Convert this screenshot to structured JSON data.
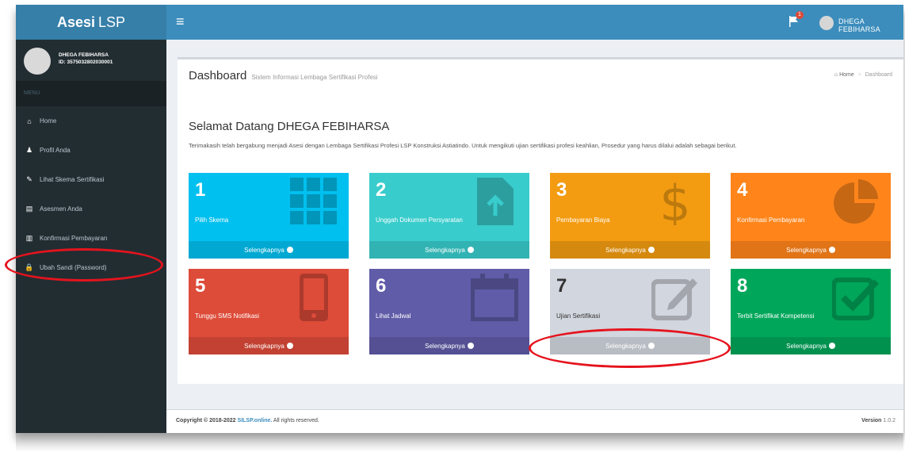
{
  "app": {
    "logo_bold": "Asesi",
    "logo_rest": "LSP"
  },
  "navbar": {
    "toggle_icon": "≡",
    "notification_count": "1",
    "user_name": "DHEGA FEBIHARSA"
  },
  "sidebar": {
    "user_name": "DHEGA FEBIHARSA",
    "user_id": "ID: 3575032802030001",
    "header": "MENU",
    "items": [
      {
        "label": "Home",
        "icon": "home-icon",
        "glyph": "⌂"
      },
      {
        "label": "Profil Anda",
        "icon": "user-icon",
        "glyph": "♟"
      },
      {
        "label": "Lihat Skema Sertifikasi",
        "icon": "edit-icon",
        "glyph": "✎"
      },
      {
        "label": "Asesmen Anda",
        "icon": "file-icon",
        "glyph": "▤"
      },
      {
        "label": "Konfirmasi Pembayaran",
        "icon": "barcode-icon",
        "glyph": "▥"
      },
      {
        "label": "Ubah Sandi (Password)",
        "icon": "lock-icon",
        "glyph": "🔒"
      }
    ]
  },
  "page": {
    "title": "Dashboard",
    "subtitle": "Sistem Informasi Lembaga Sertifikasi Profesi",
    "breadcrumb_home": "Home",
    "breadcrumb_current": "Dashboard",
    "welcome": "Selamat Datang DHEGA FEBIHARSA",
    "description": "Terimakasih telah bergabung menjadi Asesi dengan Lembaga Sertifikasi Profesi LSP Konstruksi Astiatindo. Untuk mengikuti ujian sertifikasi profesi keahlian, Prosedur yang harus dilalui adalah sebagai berikut."
  },
  "tiles": [
    {
      "number": "1",
      "label": "Pilih Skema",
      "more": "Selengkapnya",
      "color": "#00c0ef",
      "icon": "grid-icon"
    },
    {
      "number": "2",
      "label": "Unggah Dokumen Persyaratan",
      "more": "Selengkapnya",
      "color": "#39cccc",
      "icon": "document-upload-icon"
    },
    {
      "number": "3",
      "label": "Pembayaran Biaya",
      "more": "Selengkapnya",
      "color": "#f39c12",
      "icon": "dollar-icon"
    },
    {
      "number": "4",
      "label": "Konfirmasi Pembayaran",
      "more": "Selengkapnya",
      "color": "#ff851b",
      "icon": "pie-chart-icon"
    },
    {
      "number": "5",
      "label": "Tunggu SMS Notifikasi",
      "more": "Selengkapnya",
      "color": "#dd4b39",
      "icon": "mobile-phone-icon"
    },
    {
      "number": "6",
      "label": "Lihat Jadwal",
      "more": "Selengkapnya",
      "color": "#605ca8",
      "icon": "calendar-icon"
    },
    {
      "number": "7",
      "label": "Ujian Sertifikasi",
      "more": "Selengkapnya",
      "color": "#d2d6de",
      "icon": "edit-square-icon"
    },
    {
      "number": "8",
      "label": "Terbit Sertifikat Kompetensi",
      "more": "Selengkapnya",
      "color": "#00a65a",
      "icon": "check-square-icon"
    }
  ],
  "footer": {
    "copyright_prefix": "Copyright © 2018-2022",
    "site": "SILSP.online.",
    "rights": "All rights reserved.",
    "version_label": "Version",
    "version": "1.0.2"
  },
  "annotation_color": "#e5131d"
}
